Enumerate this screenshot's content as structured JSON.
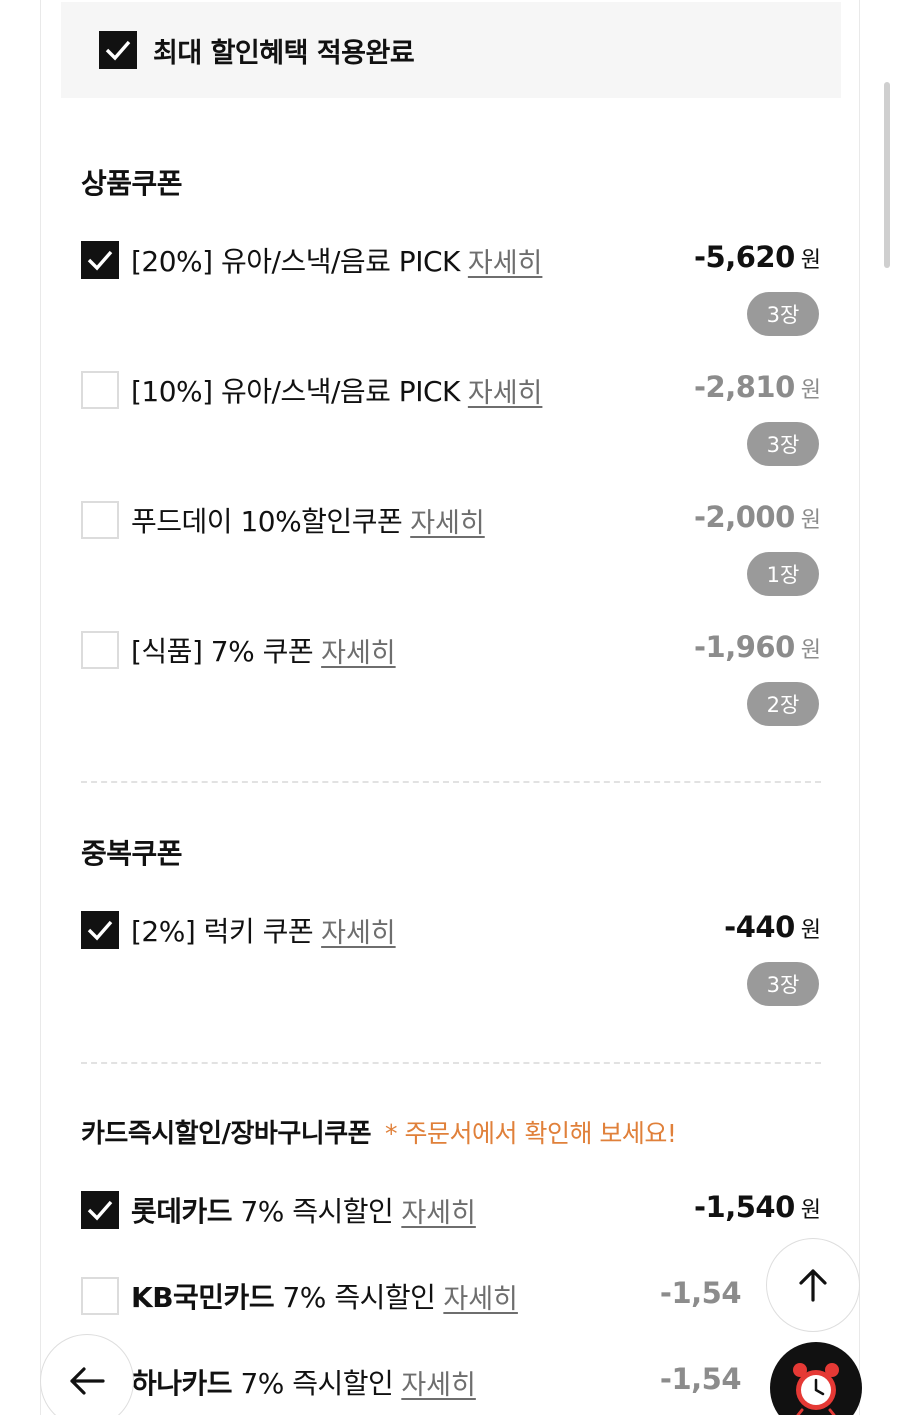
{
  "max_discount": {
    "label": "최대 할인혜택 적용완료",
    "checked": true
  },
  "product_coupons": {
    "title": "상품쿠폰",
    "items": [
      {
        "name": "[20%] 유아/스낵/음료 PICK",
        "detail": "자세히",
        "amount": "-5,620",
        "unit": "원",
        "count": "3장",
        "checked": true
      },
      {
        "name": "[10%] 유아/스낵/음료 PICK",
        "detail": "자세히",
        "amount": "-2,810",
        "unit": "원",
        "count": "3장",
        "checked": false
      },
      {
        "name": "푸드데이 10%할인쿠폰",
        "detail": "자세히",
        "amount": "-2,000",
        "unit": "원",
        "count": "1장",
        "checked": false
      },
      {
        "name": "[식품] 7% 쿠폰",
        "detail": "자세히",
        "amount": "-1,960",
        "unit": "원",
        "count": "2장",
        "checked": false
      }
    ]
  },
  "stack_coupons": {
    "title": "중복쿠폰",
    "items": [
      {
        "name": "[2%] 럭키 쿠폰",
        "detail": "자세히",
        "amount": "-440",
        "unit": "원",
        "count": "3장",
        "checked": true
      }
    ]
  },
  "card_discounts": {
    "title": "카드즉시할인/장바구니쿠폰",
    "note": "* 주문서에서 확인해 보세요!",
    "items": [
      {
        "brand": "롯데카드",
        "name": " 7% 즉시할인",
        "detail": "자세히",
        "amount": "-1,540",
        "unit": "원",
        "checked": true
      },
      {
        "brand": "KB국민카드",
        "name": " 7% 즉시할인",
        "detail": "자세히",
        "amount": "-1,54",
        "unit": "",
        "checked": false
      },
      {
        "brand": "하나카드",
        "name": " 7% 즉시할인",
        "detail": "자세히",
        "amount": "-1,54",
        "unit": "",
        "checked": false
      }
    ]
  },
  "icons": {
    "scroll_top": "arrow-up-icon",
    "back": "arrow-left-icon",
    "alarm": "alarm-clock-icon"
  },
  "colors": {
    "accent_note": "#e0803a",
    "badge": "#9a9a9a",
    "checked": "#111111"
  }
}
